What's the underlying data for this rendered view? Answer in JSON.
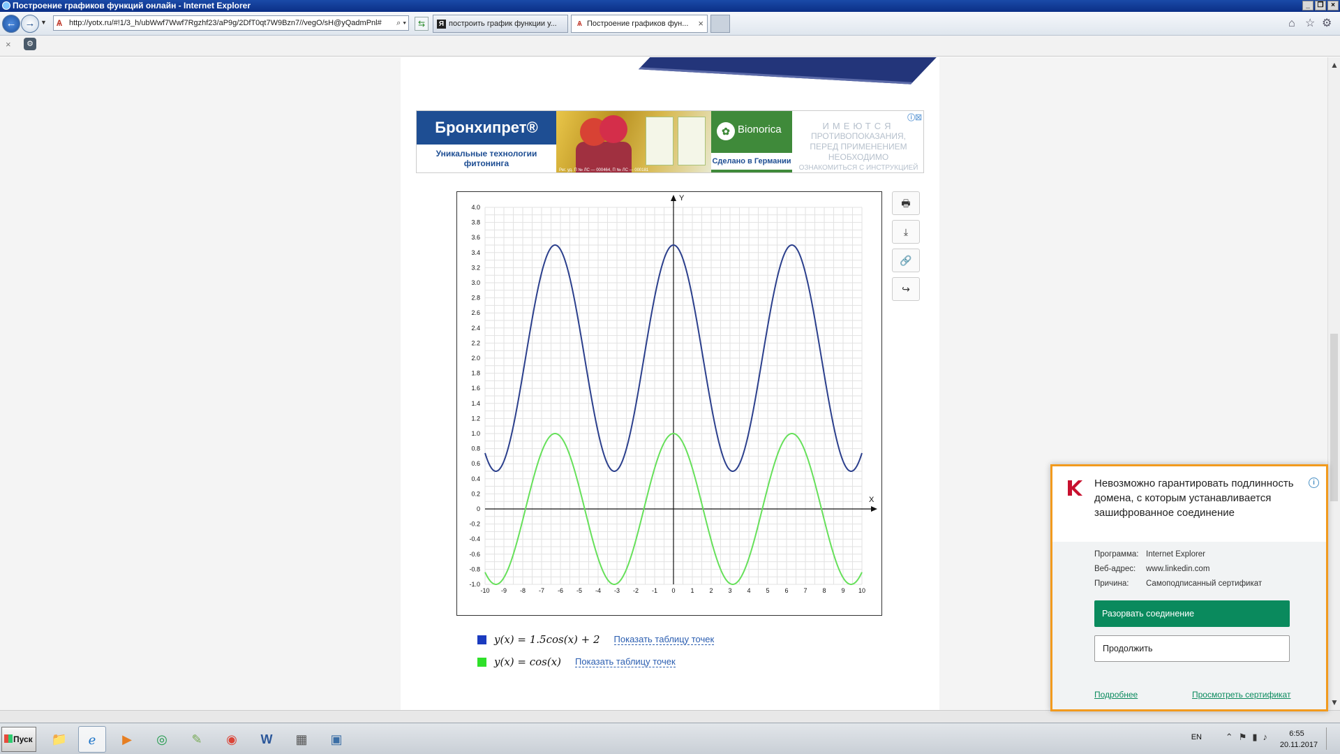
{
  "window": {
    "title": "Построение графиков функций онлайн - Internet Explorer"
  },
  "browser": {
    "url": "http://yotx.ru/#!1/3_h/ubWwf7Wwf7Rgzhf23/aP9g/2DfT0qt7W9Bzn7//vegO/sH@yQadmPnl#",
    "tabs": [
      {
        "label": "построить график функции у..."
      },
      {
        "label": "Построение графиков фун..."
      }
    ],
    "tab_close": "×"
  },
  "ad": {
    "brand": "Бронхипрет®",
    "tagline": "Уникальные технологии фитонинга",
    "bionorica": "Bionorica",
    "made_in": "Сделано в Германии",
    "caption": "Рег. уд. П № ЛС — 000464, П № ЛС — 000181",
    "warning_1": "ИМЕЮТСЯ",
    "warning_2": "ПРОТИВОПОКАЗАНИЯ,",
    "warning_3": "ПЕРЕД ПРИМЕНЕНИЕМ",
    "warning_4": "НЕОБХОДИМО",
    "warning_5": "ОЗНАКОМИТЬСЯ С ИНСТРУКЦИЕЙ"
  },
  "chart_data": {
    "type": "line",
    "xlabel": "X",
    "ylabel": "Y",
    "xlim": [
      -10,
      10
    ],
    "ylim": [
      -1.0,
      4.0
    ],
    "x_ticks": [
      -10,
      -9,
      -8,
      -7,
      -6,
      -5,
      -4,
      -3,
      -2,
      -1,
      0,
      1,
      2,
      3,
      4,
      5,
      6,
      7,
      8,
      9,
      10
    ],
    "y_ticks": [
      -1.0,
      -0.8,
      -0.6,
      -0.4,
      -0.2,
      0,
      0.2,
      0.4,
      0.6,
      0.8,
      1.0,
      1.2,
      1.4,
      1.6,
      1.8,
      2.0,
      2.2,
      2.4,
      2.6,
      2.8,
      3.0,
      3.2,
      3.4,
      3.6,
      3.8,
      4.0
    ],
    "y_tick_labels": [
      "-1.0",
      "-0.8",
      "-0.6",
      "-0.4",
      "-0.2",
      "0",
      "0.2",
      "0.4",
      "0.6",
      "0.8",
      "1.0",
      "1.2",
      "1.4",
      "1.6",
      "1.8",
      "2.0",
      "2.2",
      "2.4",
      "2.6",
      "2.8",
      "3.0",
      "3.2",
      "3.4",
      "3.6",
      "3.8",
      "4.0"
    ],
    "grid": true,
    "series": [
      {
        "name": "y(x) = 1.5cos(x) + 2",
        "color": "#2b3f8c",
        "amplitude": 1.5,
        "offset": 2
      },
      {
        "name": "y(x) = cos(x)",
        "color": "#66e05a",
        "amplitude": 1,
        "offset": 0
      }
    ]
  },
  "legend": {
    "items": [
      {
        "formula": "y(x) = 1.5cos(x) + 2",
        "link": "Показать таблицу точек",
        "color": "#1a3bbf"
      },
      {
        "formula": "y(x) = cos(x)",
        "link": "Показать таблицу точек",
        "color": "#2fe02a"
      }
    ]
  },
  "side_buttons": {
    "print": "🖶",
    "download": "⤓",
    "link": "🔗",
    "share": "↪"
  },
  "kaspersky": {
    "title": "Невозможно гарантировать подлинность домена, с которым устанавливается зашифрованное соединение",
    "rows": [
      {
        "key": "Программа:",
        "value": "Internet Explorer"
      },
      {
        "key": "Веб-адрес:",
        "value": "www.linkedin.com"
      },
      {
        "key": "Причина:",
        "value": "Самоподписанный сертификат"
      }
    ],
    "primary_button": "Разорвать соединение",
    "secondary_button": "Продолжить",
    "link_more": "Подробнее",
    "link_cert": "Просмотреть сертификат",
    "accent": "#f29a1d",
    "button_color": "#0a8a5d"
  },
  "taskbar": {
    "start_label": "Пуск",
    "lang": "EN",
    "time": "6:55",
    "date": "20.11.2017"
  }
}
